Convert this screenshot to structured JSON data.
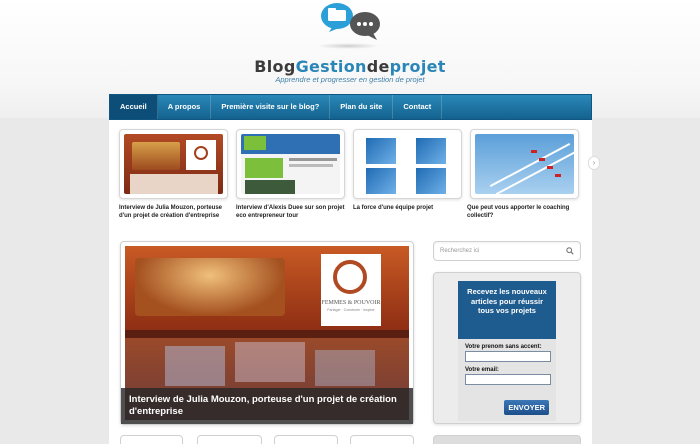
{
  "header": {
    "brand_part1": "Blog",
    "brand_part2": "Gestion",
    "brand_part3": "de",
    "brand_part4": "projet",
    "tagline": "Apprendre et progresser en gestion de projet"
  },
  "nav": {
    "items": [
      {
        "label": "Accueil",
        "active": true
      },
      {
        "label": "A propos"
      },
      {
        "label": "Première visite sur le blog?"
      },
      {
        "label": "Plan du site"
      },
      {
        "label": "Contact"
      }
    ]
  },
  "carousel": {
    "items": [
      {
        "caption": "Interview de Julia Mouzon, porteuse d'un projet de création d'entreprise"
      },
      {
        "caption": "Interview d'Alexis Duee sur son projet eco entrepreneur tour"
      },
      {
        "caption": "La force d'une équipe projet"
      },
      {
        "caption": "Que peut vous apporter le coaching collectif?"
      }
    ],
    "next_icon": "chevron-right-icon"
  },
  "feature": {
    "caption": "Interview de Julia Mouzon, porteuse d'un projet de création d'entreprise",
    "logo_text_1": "FEMMES & POUVOIR",
    "logo_text_2": "Partager · Construire · Inspirer"
  },
  "sidebar": {
    "search_placeholder": "Recherchez ici",
    "newsletter": {
      "title": "Recevez les nouveaux articles pour réussir tous vos projets",
      "first_name_label": "Votre prenom sans accent:",
      "email_label": "Votre email:",
      "submit_label": "ENVOYER"
    }
  },
  "colors": {
    "accent": "#2a88b8",
    "nav_dark": "#14628f",
    "newsletter_bg": "#1e5b8e"
  }
}
